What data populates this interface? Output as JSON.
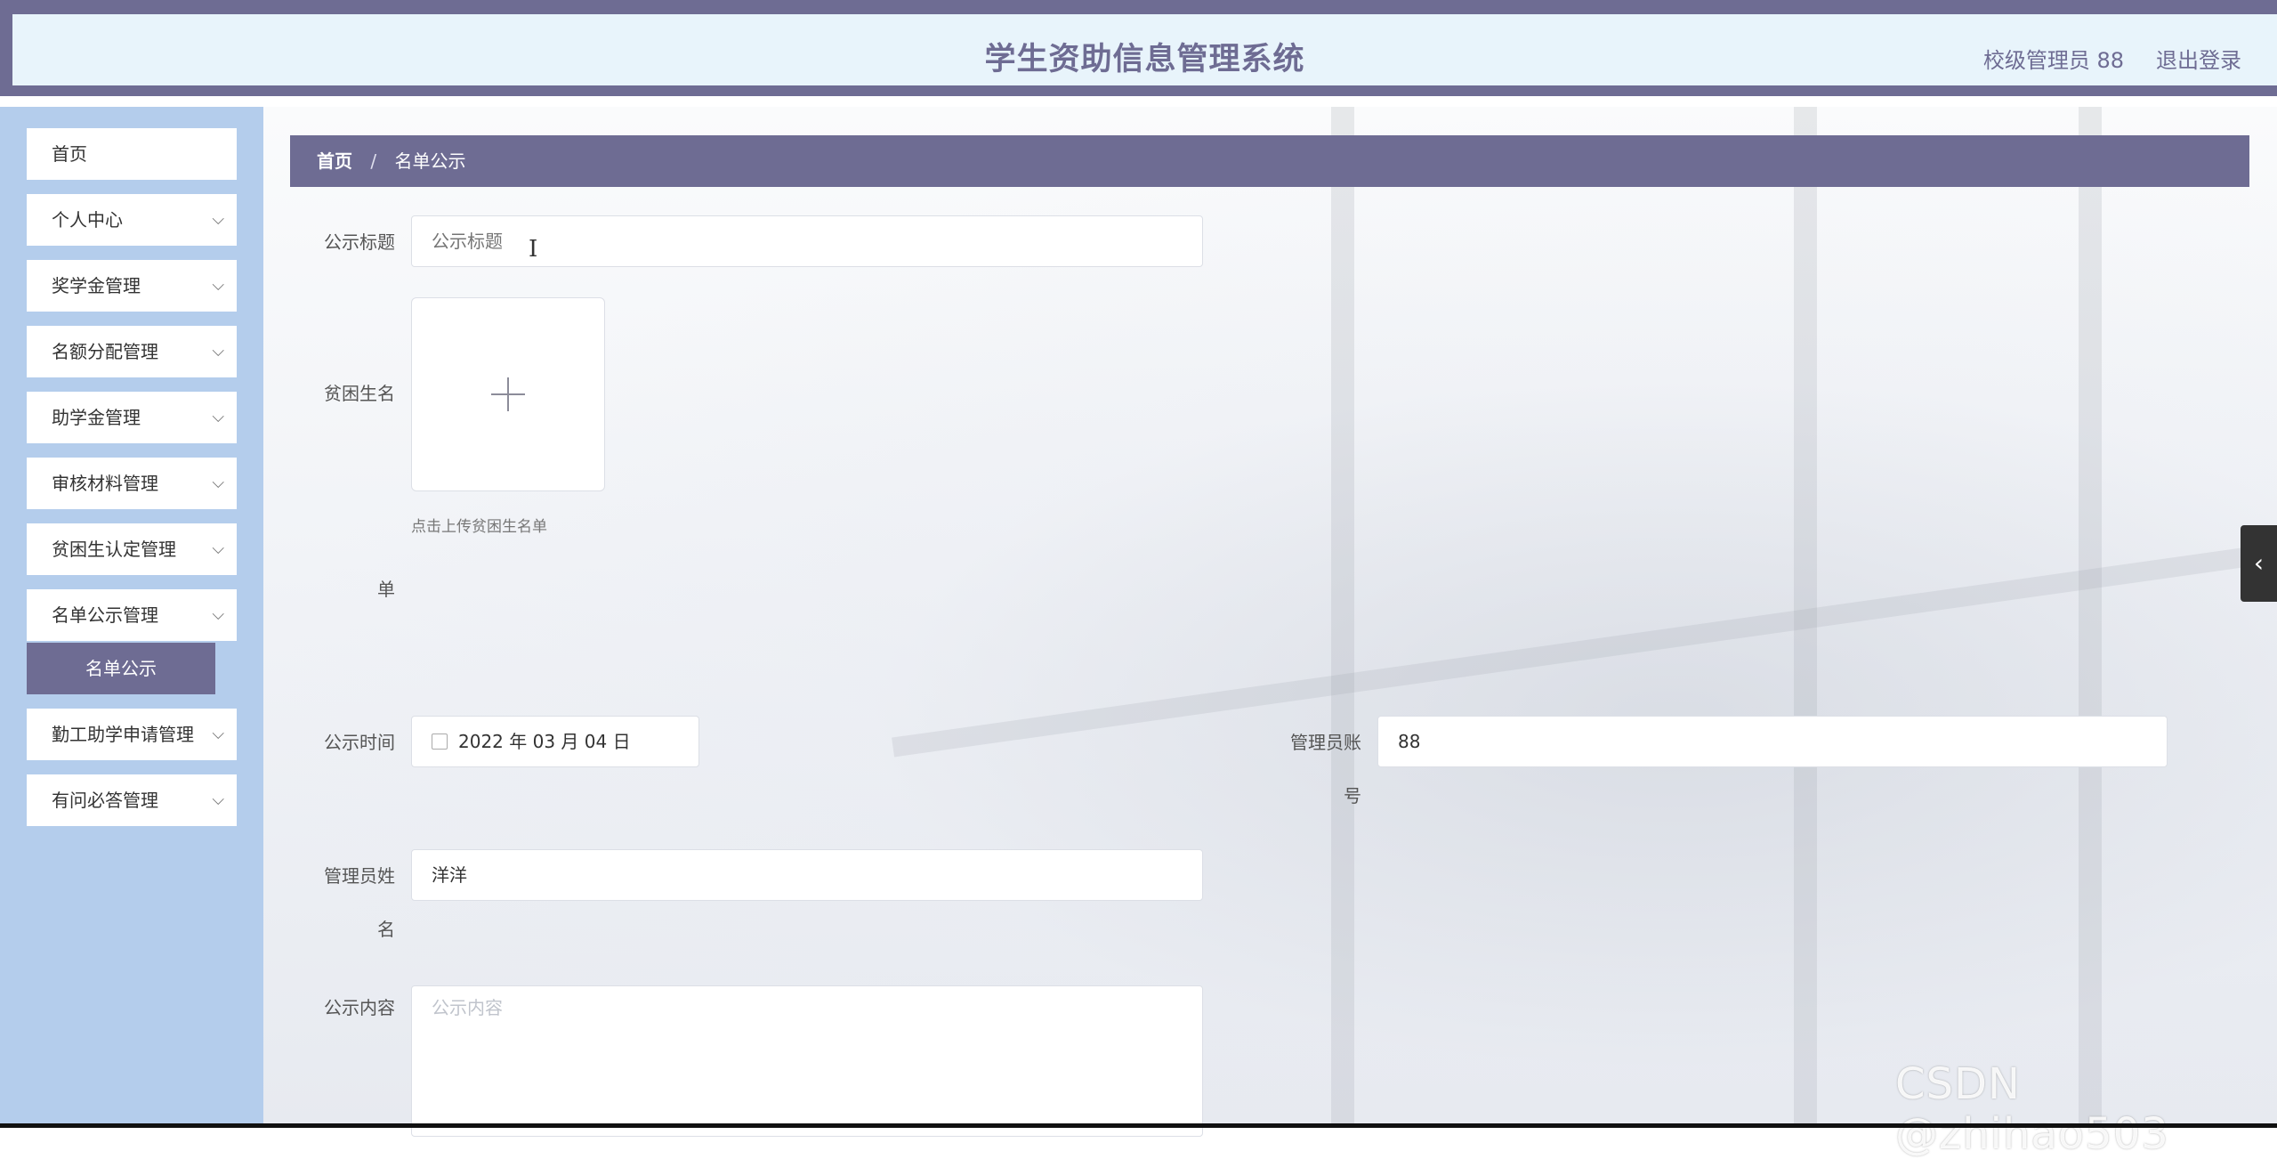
{
  "header": {
    "title": "学生资助信息管理系统",
    "user": "校级管理员 88",
    "logout": "退出登录"
  },
  "sidebar": {
    "items": [
      {
        "label": "首页"
      },
      {
        "label": "个人中心"
      },
      {
        "label": "奖学金管理"
      },
      {
        "label": "名额分配管理"
      },
      {
        "label": "助学金管理"
      },
      {
        "label": "审核材料管理"
      },
      {
        "label": "贫困生认定管理"
      },
      {
        "label": "名单公示管理"
      },
      {
        "label": "勤工助学申请管理"
      },
      {
        "label": "有问必答管理"
      }
    ],
    "active_sub": "名单公示"
  },
  "breadcrumb": {
    "home": "首页",
    "sep": "/",
    "current": "名单公示"
  },
  "form": {
    "title_label": "公示标题",
    "title_placeholder": "公示标题",
    "list_label_1": "贫困生名",
    "list_label_2": "单",
    "upload_hint": "点击上传贫困生名单",
    "time_label": "公示时间",
    "time_value": "2022 年 03 月 04 日",
    "admin_account_label_1": "管理员账",
    "admin_account_label_2": "号",
    "admin_account_value": "88",
    "admin_name_label_1": "管理员姓",
    "admin_name_label_2": "名",
    "admin_name_value": "洋洋",
    "content_label": "公示内容",
    "content_placeholder": "公示内容"
  },
  "watermark": "CSDN @zhihao503",
  "colors": {
    "accent": "#6e6c93",
    "sidebar_bg": "#b4cdec",
    "header_bg": "#e8f4fb"
  }
}
